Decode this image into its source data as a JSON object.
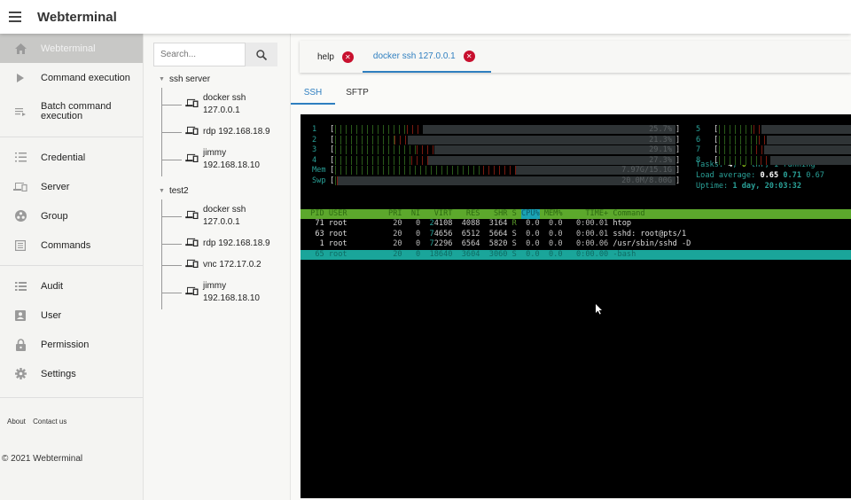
{
  "app": {
    "title": "Webterminal"
  },
  "sidebar": {
    "items": [
      {
        "label": "Webterminal",
        "icon": "home-icon",
        "active": true
      },
      {
        "label": "Command execution",
        "icon": "play-icon"
      },
      {
        "label": "Batch command execution",
        "icon": "playlist-icon"
      },
      {
        "label": "Credential",
        "icon": "numbered-list-icon"
      },
      {
        "label": "Server",
        "icon": "devices-icon"
      },
      {
        "label": "Group",
        "icon": "group-icon"
      },
      {
        "label": "Commands",
        "icon": "list-box-icon"
      },
      {
        "label": "Audit",
        "icon": "list-icon"
      },
      {
        "label": "User",
        "icon": "user-badge-icon"
      },
      {
        "label": "Permission",
        "icon": "lock-icon"
      },
      {
        "label": "Settings",
        "icon": "gear-icon"
      }
    ],
    "footer_links": [
      "About",
      "Contact us"
    ],
    "copyright": "© 2021 Webterminal"
  },
  "tree": {
    "search_placeholder": "Search...",
    "groups": [
      {
        "label": "ssh server",
        "nodes": [
          {
            "line1": "docker ssh",
            "line2": "127.0.0.1"
          },
          {
            "line1": "rdp 192.168.18.9",
            "line2": ""
          },
          {
            "line1": "jimmy",
            "line2": "192.168.18.10"
          }
        ]
      },
      {
        "label": "test2",
        "nodes": [
          {
            "line1": "docker ssh",
            "line2": "127.0.0.1"
          },
          {
            "line1": "rdp 192.168.18.9",
            "line2": ""
          },
          {
            "line1": "vnc 172.17.0.2",
            "line2": ""
          },
          {
            "line1": "jimmy",
            "line2": "192.168.18.10"
          }
        ]
      }
    ]
  },
  "tabs": [
    {
      "label": "help",
      "active": false
    },
    {
      "label": "docker ssh 127.0.0.1",
      "active": true
    }
  ],
  "subtabs": [
    {
      "label": "SSH",
      "active": true
    },
    {
      "label": "SFTP",
      "active": false
    }
  ],
  "terminal": {
    "cpu_meters": [
      {
        "label": "1",
        "value": "25.7%",
        "fraction": 0.257
      },
      {
        "label": "2",
        "value": "21.3%",
        "fraction": 0.213
      },
      {
        "label": "3",
        "value": "29.1%",
        "fraction": 0.291
      },
      {
        "label": "4",
        "value": "27.3%",
        "fraction": 0.273
      },
      {
        "label": "5",
        "value": "",
        "fraction": 0.3
      },
      {
        "label": "6",
        "value": "",
        "fraction": 0.34
      },
      {
        "label": "7",
        "value": "",
        "fraction": 0.32
      },
      {
        "label": "8",
        "value": "",
        "fraction": 0.36
      }
    ],
    "mem": {
      "label": "Mem",
      "value": "7.97G/15.1G",
      "fraction": 0.53
    },
    "swp": {
      "label": "Swp",
      "value": "20.0M/8.00G",
      "fraction": 0.003
    },
    "tasks": {
      "prefix": "Tasks: ",
      "count": "4",
      "sep": ", ",
      "thr": "0",
      "suffix": " thr; 1 running"
    },
    "load": {
      "prefix": "Load average: ",
      "v1": "0.65",
      "v2": "0.71",
      "v3": "0.67"
    },
    "uptime": {
      "prefix": "Uptime: ",
      "value": "1 day, 20:03:32"
    },
    "columns": [
      "PID",
      "USER",
      "PRI",
      "NI",
      "VIRT",
      "RES",
      "SHR",
      "S",
      "CPU%",
      "MEM%",
      "TIME+",
      "Command"
    ],
    "processes": [
      {
        "pid": "71",
        "user": "root",
        "pri": "20",
        "ni": "0",
        "virt": "24108",
        "res": "4088",
        "shr": "3164",
        "s": "R",
        "cpu": "0.0",
        "mem": "0.0",
        "time": "0:00.01",
        "cmd": "htop"
      },
      {
        "pid": "63",
        "user": "root",
        "pri": "20",
        "ni": "0",
        "virt": "74656",
        "res": "6512",
        "shr": "5664",
        "s": "S",
        "cpu": "0.0",
        "mem": "0.0",
        "time": "0:00.01",
        "cmd": "sshd: root@pts/1"
      },
      {
        "pid": "1",
        "user": "root",
        "pri": "20",
        "ni": "0",
        "virt": "72296",
        "res": "6564",
        "shr": "5820",
        "s": "S",
        "cpu": "0.0",
        "mem": "0.0",
        "time": "0:00.06",
        "cmd": "/usr/sbin/sshd -D"
      },
      {
        "pid": "65",
        "user": "root",
        "pri": "20",
        "ni": "0",
        "virt": "18640",
        "res": "3604",
        "shr": "3060",
        "s": "S",
        "cpu": "0.0",
        "mem": "0.0",
        "time": "0:00.00",
        "cmd": "-bash",
        "selected": true
      }
    ]
  }
}
